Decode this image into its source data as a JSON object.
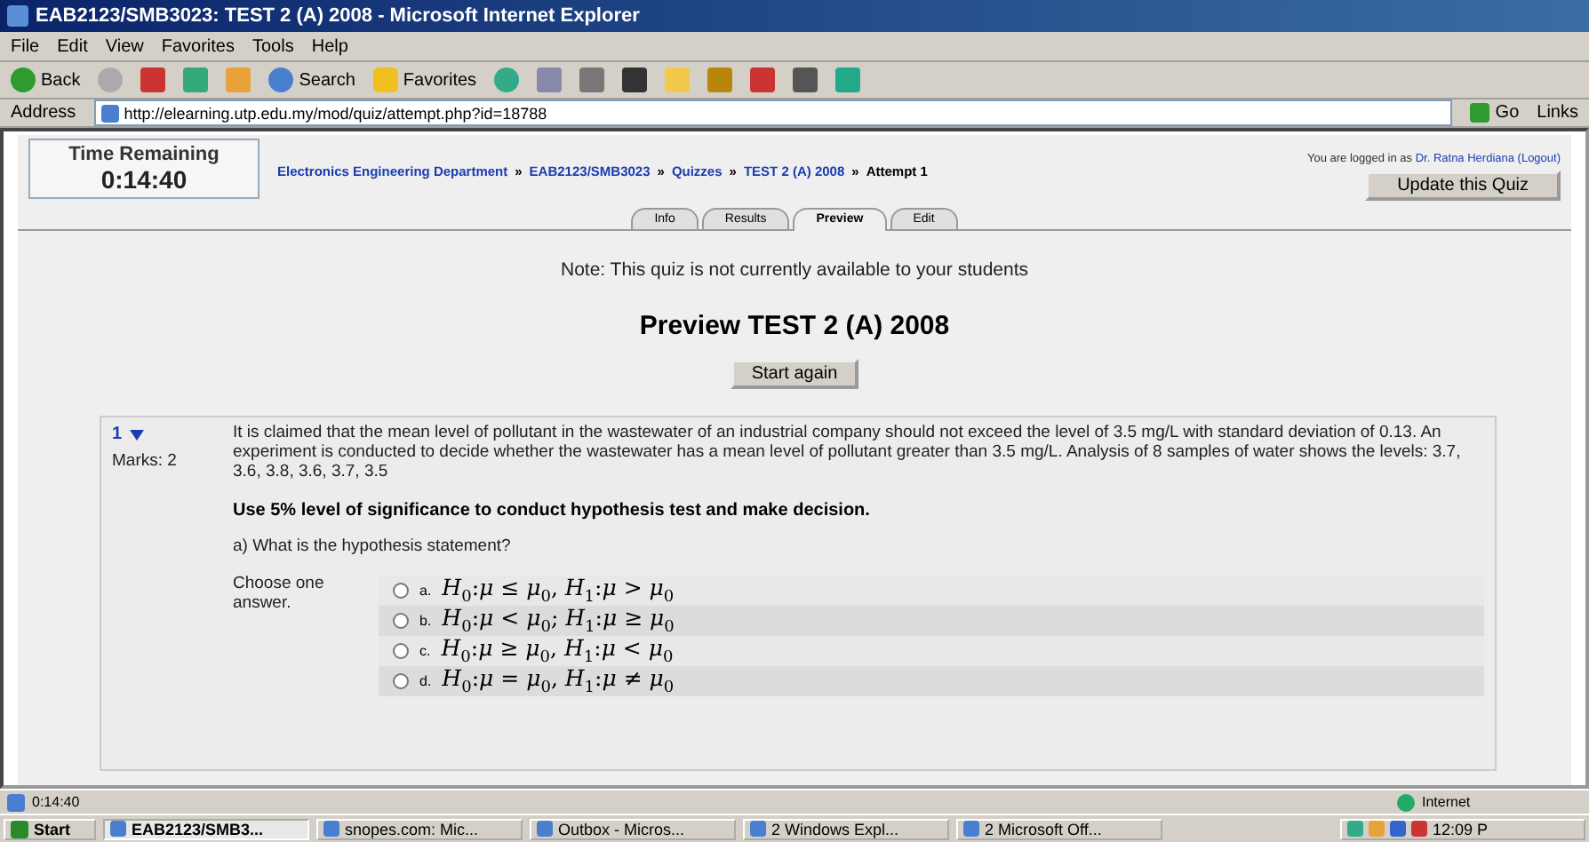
{
  "window": {
    "title": "EAB2123/SMB3023: TEST 2 (A) 2008 - Microsoft Internet Explorer"
  },
  "menu": [
    "File",
    "Edit",
    "View",
    "Favorites",
    "Tools",
    "Help"
  ],
  "toolbar": {
    "back": "Back",
    "search": "Search",
    "favorites": "Favorites"
  },
  "address": {
    "label": "Address",
    "url": "http://elearning.utp.edu.my/mod/quiz/attempt.php?id=18788",
    "go": "Go",
    "links": "Links"
  },
  "timer": {
    "label": "Time Remaining",
    "value": "0:14:40"
  },
  "breadcrumb": [
    {
      "text": "Electronics Engineering Department",
      "link": true
    },
    {
      "text": "EAB2123/SMB3023",
      "link": true
    },
    {
      "text": "Quizzes",
      "link": true
    },
    {
      "text": "TEST 2 (A) 2008",
      "link": true
    },
    {
      "text": "Attempt 1",
      "link": false
    }
  ],
  "breadcrumb_separator": "»",
  "login": {
    "prefix": "You are logged in as",
    "user": "Dr. Ratna Herdiana (Logout)"
  },
  "update_button": "Update this Quiz",
  "tabs": [
    {
      "label": "Info",
      "selected": false
    },
    {
      "label": "Results",
      "selected": false
    },
    {
      "label": "Preview",
      "selected": true
    },
    {
      "label": "Edit",
      "selected": false
    }
  ],
  "note": "Note: This quiz is not currently available to your students",
  "heading": "Preview TEST 2 (A) 2008",
  "start_button": "Start again",
  "question": {
    "number": "1",
    "marks": "Marks: 2",
    "text": "It is claimed that the mean level of pollutant in the wastewater of an industrial company should not exceed the level of 3.5 mg/L with standard deviation of 0.13.  An experiment is conducted to decide whether the wastewater has a mean level of pollutant greater than 3.5 mg/L.  Analysis of 8 samples of water shows the levels: 3.7,  3.6,  3.8,  3.6,  3.7,  3.5",
    "instruction": "Use 5% level of significance to conduct hypothesis test and make decision.",
    "prompt": "a) What is the hypothesis statement?",
    "choose": "Choose one answer.",
    "options": [
      {
        "letter": "a.",
        "formula": "*H*$_{0}$:*μ* ≤ *μ*$_{0}$, *H*$_{1}$:*μ* > *μ*$_{0}$",
        "selected": false
      },
      {
        "letter": "b.",
        "formula": "*H*$_{0}$:*μ* < *μ*$_{0}$; *H*$_{1}$:*μ* ≥ *μ*$_{0}$",
        "selected": false
      },
      {
        "letter": "c.",
        "formula": "*H*$_{0}$:*μ* ≥ *μ*$_{0}$, *H*$_{1}$:*μ* < *μ*$_{0}$",
        "selected": false
      },
      {
        "letter": "d.",
        "formula": "*H*$_{0}$:*μ* = *μ*$_{0}$, *H*$_{1}$:*μ* ≠ *μ*$_{0}$",
        "selected": false
      }
    ]
  },
  "status_bar": {
    "text": "0:14:40",
    "zone": "Internet"
  },
  "taskbar": {
    "start": "Start",
    "items": [
      {
        "label": "EAB2123/SMB3...",
        "selected": true
      },
      {
        "label": "snopes.com: Mic...",
        "selected": false
      },
      {
        "label": "Outbox - Micros...",
        "selected": false
      },
      {
        "label": "2 Windows Expl...",
        "selected": false
      },
      {
        "label": "2 Microsoft Off...",
        "selected": false
      }
    ],
    "clock": "12:09 P"
  }
}
